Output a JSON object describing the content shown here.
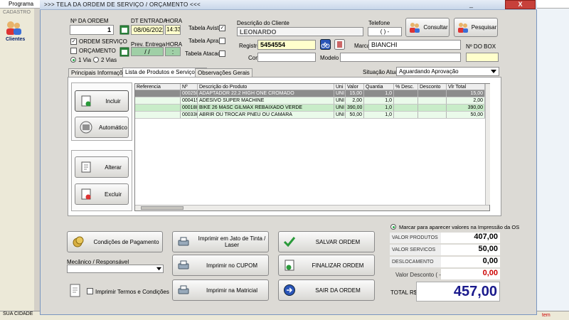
{
  "background": {
    "title": "Programa",
    "side_label": "CADASTRO",
    "clientes": "Clientes",
    "status_text": "SUA CIDADE",
    "right_text": "tem"
  },
  "dialog": {
    "title": ">>>  TELA DA ORDEM DE SERVIÇO / ORÇAMENTO  <<<",
    "close": "X",
    "minimize": "_"
  },
  "header": {
    "ordem_label": "Nº DA ORDEM",
    "ordem_value": "1",
    "dt_entrada_label": "DT ENTRADA",
    "dt_entrada_value": "08/06/2022",
    "hora_label": "HORA",
    "hora_value": "14:33",
    "prev_entrega_label": "Prev. Entrega",
    "prev_entrega_value": "  /  /  ",
    "hora2_label": "HORA",
    "hora2_value": " : ",
    "ordem_servico_label": "ORDEM SERVIÇO",
    "orcamento_label": "ORÇAMENTO",
    "via1_label": "1 Via",
    "via2_label": "2 Vias",
    "tabela_avista": "Tabela Avista",
    "tabela_aprazo": "Tabela Aprazo",
    "tabela_atacado": "Tabela Atacado",
    "descricao_cliente_label": "Descrição do Cliente",
    "cliente_value": "LEONARDO",
    "telefone_label": "Telefone",
    "telefone_value": "(  )  -",
    "consultar": "Consultar",
    "pesquisar": "Pesquisar",
    "registro_label": "Registro",
    "registro_value": "5454554",
    "marca_label": "Marca",
    "marca_value": "BIANCHI",
    "no_box_label": "Nº DO BOX",
    "cor_label": "Cor",
    "modelo_label": "Modelo"
  },
  "tabs": [
    {
      "label": "Principais Informações ->"
    },
    {
      "label": "Lista de Produtos e Serviços ->"
    },
    {
      "label": "Observações Gerais"
    }
  ],
  "situacao": {
    "label": "Situação Atual:",
    "value": "Aguardando Aprovação"
  },
  "side_buttons": {
    "incluir": "Incluir",
    "automatico": "Automático",
    "alterar": "Alterar",
    "excluir": "Excluir"
  },
  "table": {
    "headers": [
      "Referencia",
      "Nº",
      "Descrição do Produto",
      "Uni",
      "Valor",
      "Quantia",
      "% Desc.",
      "Desconto",
      "Vlr Total"
    ],
    "rows": [
      [
        "",
        "000250",
        "ADAPTADOR 22.2 HIGH ONE CROMADO",
        "UNI",
        "15,00",
        "1,0",
        "",
        "",
        "15,00"
      ],
      [
        "",
        "000415",
        "ADESIVO SUPER MACHINE",
        "UNI",
        "2,00",
        "1,0",
        "",
        "",
        "2,00"
      ],
      [
        "",
        "000188",
        "BIKE 26 MASC GILMAX REBAIXADO VERDE",
        "UNI",
        "390,00",
        "1,0",
        "",
        "",
        "390,00"
      ],
      [
        "",
        "000336",
        "ABRIR OU TROCAR PNEU OU CAMARA",
        "UNI",
        "50,00",
        "1,0",
        "",
        "",
        "50,00"
      ]
    ]
  },
  "bottom": {
    "condicoes": "Condições de Pagamento",
    "mecanico_label": "Mecânico / Responsável",
    "imprimir_termos": "Imprimir Termos e Condições",
    "imprimir_jato": "Imprimir em Jato de Tinta / Laser",
    "imprimir_cupom": "Imprimir no CUPOM",
    "imprimir_matricial": "Imprimir na Matricial",
    "salvar": "SALVAR ORDEM",
    "finalizar": "FINALIZAR ORDEM",
    "sair": "SAIR DA ORDEM"
  },
  "totals": {
    "marcar_label": "Marcar para aparecer valores na Impressão da OS",
    "produtos_label": "VALOR PRODUTOS",
    "produtos_value": "407,00",
    "servicos_label": "VALOR SERVICOS",
    "servicos_value": "50,00",
    "deslocamento_label": "DESLOCAMENTO",
    "deslocamento_value": "0,00",
    "desconto_label": "Valor Desconto ( - )",
    "desconto_value": "0,00",
    "total_label": "TOTAL R$",
    "total_value": "457,00"
  },
  "colors": {
    "accent_blue": "#1a1a8c",
    "desconto_red": "#cc0000",
    "row_green": "#c8ecc8"
  }
}
